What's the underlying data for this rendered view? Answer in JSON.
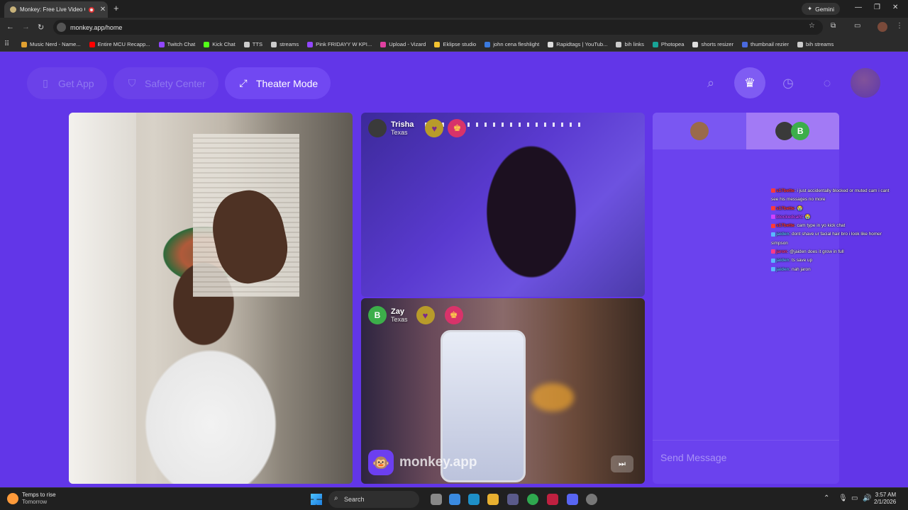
{
  "browser": {
    "tab_title": "Monkey: Free Live Video Ch",
    "url": "monkey.app/home",
    "gemini_label": "Gemini",
    "bookmarks": [
      {
        "label": "Music Nerd - Name...",
        "color": "#e0a030"
      },
      {
        "label": "Entire MCU Recapp...",
        "color": "#ff0000"
      },
      {
        "label": "Twitch Chat",
        "color": "#9146ff"
      },
      {
        "label": "Kick Chat",
        "color": "#53fc18"
      },
      {
        "label": "TTS",
        "color": "#cccccc"
      },
      {
        "label": "streams",
        "color": "#cccccc"
      },
      {
        "label": "Pink FRIDAYY W KPI...",
        "color": "#9146ff"
      },
      {
        "label": "Upload - Vizard",
        "color": "#e040a0"
      },
      {
        "label": "Eklipse studio",
        "color": "#f2c230"
      },
      {
        "label": "john cena fleshlight",
        "color": "#3a7adf"
      },
      {
        "label": "Rapidtags | YouTub...",
        "color": "#dddddd"
      },
      {
        "label": "bih links",
        "color": "#cccccc"
      },
      {
        "label": "Photopea",
        "color": "#18a497"
      },
      {
        "label": "shorts resizer",
        "color": "#dddddd"
      },
      {
        "label": "thumbnail rezier",
        "color": "#4a6adf"
      },
      {
        "label": "bih streams",
        "color": "#cccccc"
      }
    ]
  },
  "app": {
    "nav": {
      "get_app": "Get App",
      "safety_center": "Safety Center",
      "theater_mode": "Theater Mode"
    },
    "videos": {
      "top": {
        "name": "Trisha",
        "location": "Texas"
      },
      "bottom": {
        "name": "Zay",
        "location": "Texas",
        "avatar_letter": "B"
      },
      "watermark": "monkey.app"
    },
    "side": {
      "tab_b_letter": "B",
      "send_placeholder": "Send Message"
    },
    "overlay_chat": [
      {
        "user": "s17bette",
        "user_color": "#ff3a3a",
        "text": ": i just accidentally blocked or muted cam i cant"
      },
      {
        "user": "",
        "user_color": "#ffffff",
        "text": "see his messages no more"
      },
      {
        "user": "s17bette",
        "user_color": "#ff3a3a",
        "text": ": 😭"
      },
      {
        "user": "blockedcaht",
        "user_color": "#d040ff",
        "text": ": 😭"
      },
      {
        "user": "s17bette",
        "user_color": "#ff3a3a",
        "text": ": cam type in yo kick chat"
      },
      {
        "user": "jaiden",
        "user_color": "#5ab8ff",
        "text": ": dont shave ur facial hair bro i look like homer"
      },
      {
        "user": "",
        "user_color": "#ffffff",
        "text": "simpson"
      },
      {
        "user": "jaron",
        "user_color": "#ff3a8a",
        "text": ": @jaiden does it grow in full"
      },
      {
        "user": "jaiden",
        "user_color": "#5ab8ff",
        "text": ": ts save up"
      },
      {
        "user": "jaiden",
        "user_color": "#5ab8ff",
        "text": ": nah jaron"
      }
    ]
  },
  "taskbar": {
    "weather_line1": "Temps to rise",
    "weather_line2": "Tomorrow",
    "search_placeholder": "Search",
    "time": "3:57 AM",
    "date": "2/1/2026"
  }
}
